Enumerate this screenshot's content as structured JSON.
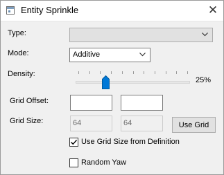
{
  "window": {
    "title": "Entity Sprinkle",
    "close_glyph": "✕",
    "icon": "app-window-icon"
  },
  "type_field": {
    "label": "Type:",
    "value": ""
  },
  "mode_field": {
    "label": "Mode:",
    "value": "Additive"
  },
  "density": {
    "label": "Density:",
    "value_text": "25%",
    "fraction": 0.25
  },
  "grid_offset": {
    "label": "Grid Offset:",
    "x": "",
    "y": ""
  },
  "grid_size": {
    "label": "Grid Size:",
    "x": "64",
    "y": "64",
    "button_label": "Use Grid"
  },
  "use_grid_size_from_definition": {
    "label": "Use Grid Size from Definition",
    "checked": true
  },
  "random_yaw": {
    "label": "Random Yaw",
    "checked": false
  },
  "colors": {
    "accent": "#0078d7",
    "window_bg": "#f0f0f0"
  }
}
